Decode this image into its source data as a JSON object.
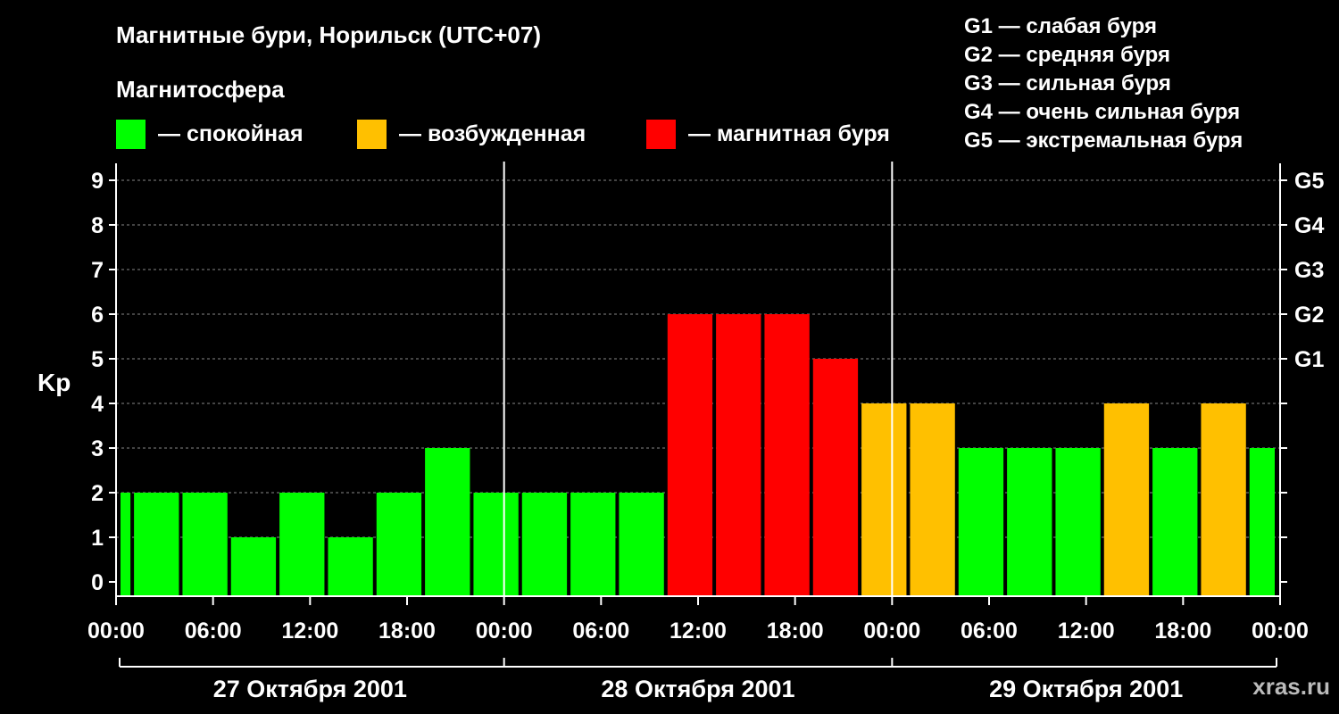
{
  "title": "Магнитные бури, Норильск (UTC+07)",
  "magnetosphere_label": "Магнитосфера",
  "legend": [
    {
      "color": "#00ff00",
      "label": "— спокойная"
    },
    {
      "color": "#ffc000",
      "label": "— возбужденная"
    },
    {
      "color": "#ff0000",
      "label": "— магнитная буря"
    }
  ],
  "g_scale": [
    "G1 — слабая буря",
    "G2 — средняя буря",
    "G3 — сильная буря",
    "G4 — очень сильная буря",
    "G5 — экстремальная буря"
  ],
  "watermark": "xras.ru",
  "chart_data": {
    "type": "bar",
    "ylabel": "Kp",
    "ylim": [
      0,
      9
    ],
    "yticks": [
      0,
      1,
      2,
      3,
      4,
      5,
      6,
      7,
      8,
      9
    ],
    "right_ticks": [
      {
        "value": 5,
        "label": "G1"
      },
      {
        "value": 6,
        "label": "G2"
      },
      {
        "value": 7,
        "label": "G3"
      },
      {
        "value": 8,
        "label": "G4"
      },
      {
        "value": 9,
        "label": "G5"
      }
    ],
    "x_tick_labels": [
      "00:00",
      "06:00",
      "12:00",
      "18:00",
      "00:00",
      "06:00",
      "12:00",
      "18:00",
      "00:00",
      "06:00",
      "12:00",
      "18:00",
      "00:00"
    ],
    "days": [
      "27 Октября 2001",
      "28 Октября 2001",
      "29 Октября 2001"
    ],
    "interval_hours": 3,
    "hours_start": -2,
    "values": [
      2,
      2,
      2,
      1,
      2,
      1,
      2,
      3,
      2,
      2,
      2,
      2,
      6,
      6,
      6,
      5,
      4,
      4,
      3,
      3,
      3,
      4,
      3,
      4,
      3
    ],
    "color_rule": {
      "quiet_below": 4,
      "storm_from": 5
    },
    "colors": {
      "quiet": "#00ff00",
      "active": "#ffc000",
      "storm": "#ff0000",
      "grid": "#888888",
      "axis": "#ffffff"
    },
    "grid": true
  }
}
